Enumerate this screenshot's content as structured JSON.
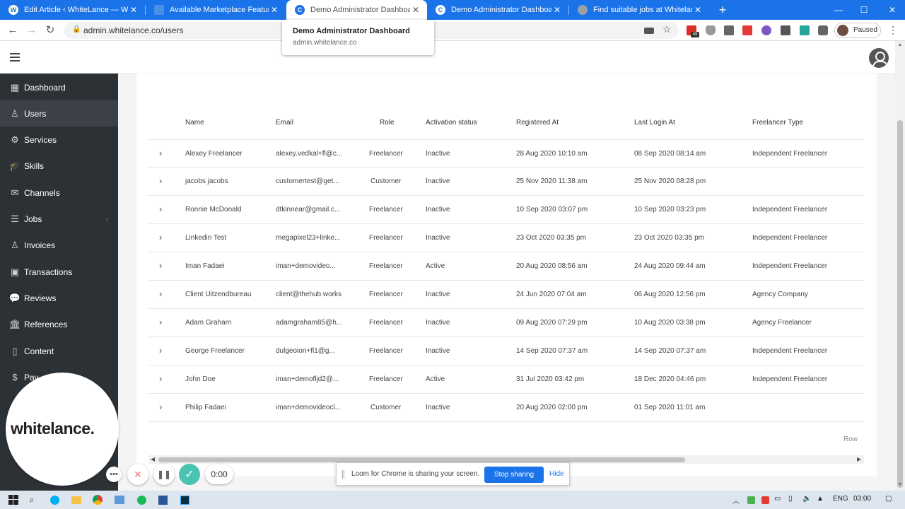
{
  "browser": {
    "tabs": [
      {
        "title": "Edit Article ‹ WhiteLance — Wor",
        "icon": "wordpress-icon",
        "active": false
      },
      {
        "title": "Available Marketplace Features |",
        "icon": "page-icon",
        "active": false
      },
      {
        "title": "Demo Administrator Dashboard",
        "icon": "whitelance-icon",
        "active": true
      },
      {
        "title": "Demo Administrator Dashboard",
        "icon": "whitelance-icon",
        "active": false
      },
      {
        "title": "Find suitable jobs at Whitelance.",
        "icon": "globe-icon",
        "active": false
      }
    ],
    "new_tab": "+",
    "url": "admin.whitelance.co/users",
    "profile_status": "Paused",
    "extension_badge": "49",
    "hover_card": {
      "title": "Demo Administrator Dashboard",
      "url": "admin.whitelance.co"
    },
    "tab_bar_color": "#1a73e8"
  },
  "sidebar": {
    "items": [
      {
        "label": "Dashboard",
        "icon": "dashboard-icon",
        "glyph": "▦"
      },
      {
        "label": "Users",
        "icon": "user-icon",
        "glyph": "♙",
        "active": true
      },
      {
        "label": "Services",
        "icon": "gear-icon",
        "glyph": "⚙"
      },
      {
        "label": "Skills",
        "icon": "graduation-cap-icon",
        "glyph": "🎓"
      },
      {
        "label": "Channels",
        "icon": "envelope-icon",
        "glyph": "✉"
      },
      {
        "label": "Jobs",
        "icon": "list-icon",
        "glyph": "☰",
        "chevron": "‹"
      },
      {
        "label": "Invoices",
        "icon": "user-invoice-icon",
        "glyph": "♙"
      },
      {
        "label": "Transactions",
        "icon": "money-icon",
        "glyph": "▣"
      },
      {
        "label": "Reviews",
        "icon": "comments-icon",
        "glyph": "💬"
      },
      {
        "label": "References",
        "icon": "bank-icon",
        "glyph": "🏛"
      },
      {
        "label": "Content",
        "icon": "file-icon",
        "glyph": "▯"
      },
      {
        "label": "Pay",
        "icon": "dollar-icon",
        "glyph": "$"
      }
    ],
    "background": "#2c3136"
  },
  "users_table": {
    "columns": [
      "Name",
      "Email",
      "Role",
      "Activation status",
      "Registered At",
      "Last Login At",
      "Freelancer Type"
    ],
    "rows": [
      {
        "name": "Alexey Freelancer",
        "email": "alexey.vedkal+fl@c...",
        "role": "Freelancer",
        "status": "Inactive",
        "registered": "28 Aug 2020 10:10 am",
        "last_login": "08 Sep 2020 08:14 am",
        "type": "Independent Freelancer"
      },
      {
        "name": "jacobs jacobs",
        "email": "customertest@get...",
        "role": "Customer",
        "status": "Inactive",
        "registered": "25 Nov 2020 11:38 am",
        "last_login": "25 Nov 2020 08:28 pm",
        "type": ""
      },
      {
        "name": "Ronnie McDonald",
        "email": "dtkinnear@gmail.c...",
        "role": "Freelancer",
        "status": "Inactive",
        "registered": "10 Sep 2020 03:07 pm",
        "last_login": "10 Sep 2020 03:23 pm",
        "type": "Independent Freelancer"
      },
      {
        "name": "Linkedin Test",
        "email": "megapixel23+linke...",
        "role": "Freelancer",
        "status": "Inactive",
        "registered": "23 Oct 2020 03:35 pm",
        "last_login": "23 Oct 2020 03:35 pm",
        "type": "Independent Freelancer"
      },
      {
        "name": "Iman Fadaei",
        "email": "iman+demovideo...",
        "role": "Freelancer",
        "status": "Active",
        "registered": "20 Aug 2020 08:56 am",
        "last_login": "24 Aug 2020 09:44 am",
        "type": "Independent Freelancer"
      },
      {
        "name": "Client Uitzendbureau",
        "email": "client@thehub.works",
        "role": "Freelancer",
        "status": "Inactive",
        "registered": "24 Jun 2020 07:04 am",
        "last_login": "06 Aug 2020 12:56 pm",
        "type": "Agency Company"
      },
      {
        "name": "Adam Graham",
        "email": "adamgraham85@h...",
        "role": "Freelancer",
        "status": "Inactive",
        "registered": "09 Aug 2020 07:29 pm",
        "last_login": "10 Aug 2020 03:38 pm",
        "type": "Agency Freelancer"
      },
      {
        "name": "George Freelancer",
        "email": "dulgeoion+fl1@g...",
        "role": "Freelancer",
        "status": "Inactive",
        "registered": "14 Sep 2020 07:37 am",
        "last_login": "14 Sep 2020 07:37 am",
        "type": "Independent Freelancer"
      },
      {
        "name": "John Doe",
        "email": "iman+demofljd2@...",
        "role": "Freelancer",
        "status": "Active",
        "registered": "31 Jul 2020 03:42 pm",
        "last_login": "18 Dec 2020 04:46 pm",
        "type": "Independent Freelancer"
      },
      {
        "name": "Philip Fadaei",
        "email": "iman+demovideocl...",
        "role": "Customer",
        "status": "Inactive",
        "registered": "20 Aug 2020 02:00 pm",
        "last_login": "01 Sep 2020 11:01 am",
        "type": ""
      }
    ],
    "rows_label": "Row"
  },
  "loom": {
    "logo": "whitelance.",
    "timer": "0:00",
    "share_text": "Loom for Chrome is sharing your screen.",
    "stop_label": "Stop sharing",
    "hide_label": "Hide",
    "accent": "#4cc3b0"
  },
  "taskbar": {
    "language": "ENG",
    "time": "03:00"
  }
}
